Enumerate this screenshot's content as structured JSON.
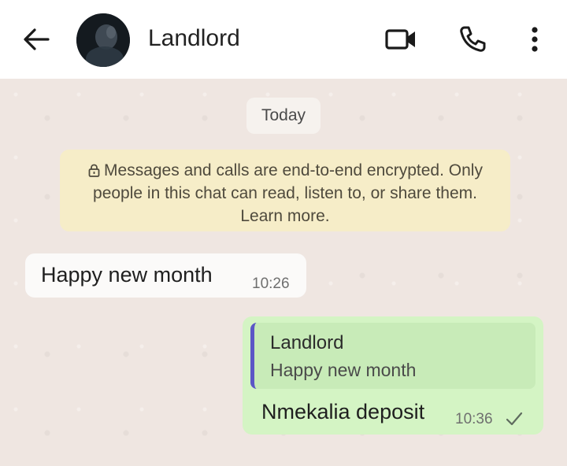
{
  "header": {
    "contact_name": "Landlord",
    "icons": {
      "back": "back-arrow-icon",
      "avatar": "contact-avatar",
      "video": "video-camera-icon",
      "call": "phone-icon",
      "menu": "more-vertical-icon"
    }
  },
  "chat": {
    "date_chip": "Today",
    "encryption_notice": {
      "icon": "lock-icon",
      "text": "Messages and calls are end-to-end encrypted. Only people in this chat can read, listen to, or share them. Learn more."
    },
    "messages": [
      {
        "direction": "incoming",
        "text": "Happy new month",
        "time": "10:26"
      },
      {
        "direction": "outgoing",
        "quote": {
          "author": "Landlord",
          "text": "Happy new month"
        },
        "text": "Nmekalia deposit",
        "time": "10:36",
        "status": "sent"
      }
    ]
  },
  "colors": {
    "header_bg": "#ffffff",
    "chat_bg": "#efe6e1",
    "incoming_bubble": "#fbfaf9",
    "outgoing_bubble": "#d4f4c4",
    "quote_bar": "#5b56c6",
    "notice_bg": "#f6edc8"
  }
}
